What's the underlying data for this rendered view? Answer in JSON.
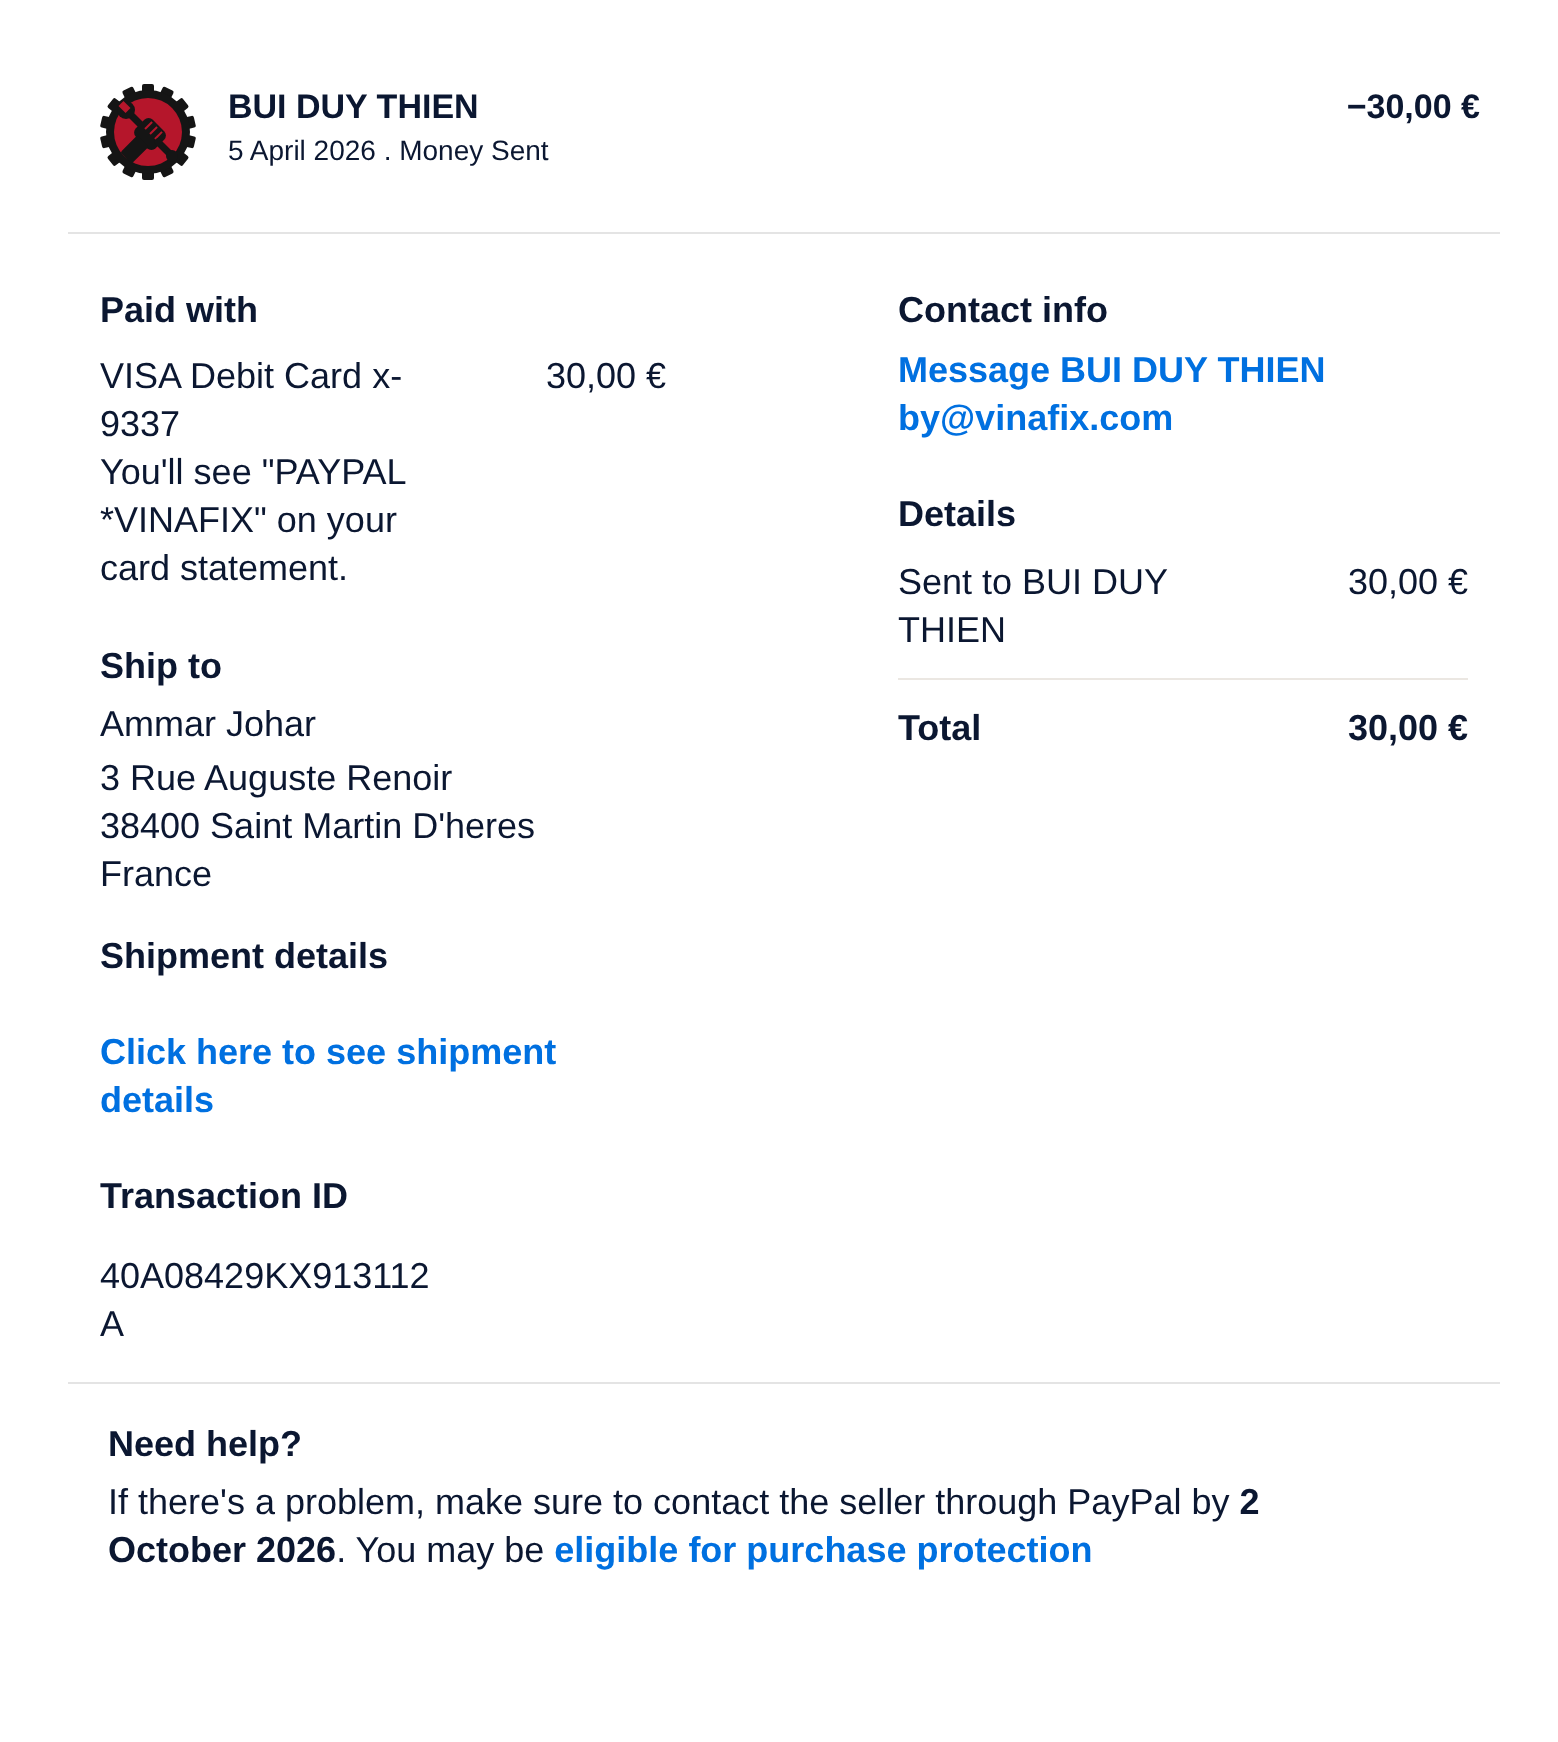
{
  "header": {
    "merchant": "BUI DUY THIEN",
    "subtitle": "5 April 2026 . Money Sent",
    "amount": "−30,00 €"
  },
  "paid_with": {
    "heading": "Paid with",
    "method": "VISA Debit Card x-9337",
    "note": "You'll see \"PAYPAL *VINAFIX\" on your card statement.",
    "amount": "30,00 €"
  },
  "ship_to": {
    "heading": "Ship to",
    "name": "Ammar Johar",
    "address_lines": [
      "3 Rue Auguste Renoir",
      "38400 Saint Martin D'heres",
      "France"
    ]
  },
  "shipment_details": {
    "heading": "Shipment details",
    "link": "Click here to see shipment details"
  },
  "transaction": {
    "heading": "Transaction ID",
    "id": "40A08429KX913112A"
  },
  "contact_info": {
    "heading": "Contact info",
    "message_link": "Message BUI DUY THIEN",
    "email": "by@vinafix.com"
  },
  "details": {
    "heading": "Details",
    "items": [
      {
        "label": "Sent to BUI DUY THIEN",
        "amount": "30,00 €"
      }
    ],
    "total": {
      "label": "Total",
      "amount": "30,00 €"
    }
  },
  "help": {
    "heading": "Need help?",
    "text": "If there's a problem, make sure to contact the seller through PayPal by **2 October 2026**. You may be",
    "link": "eligible for purchase protection"
  }
}
